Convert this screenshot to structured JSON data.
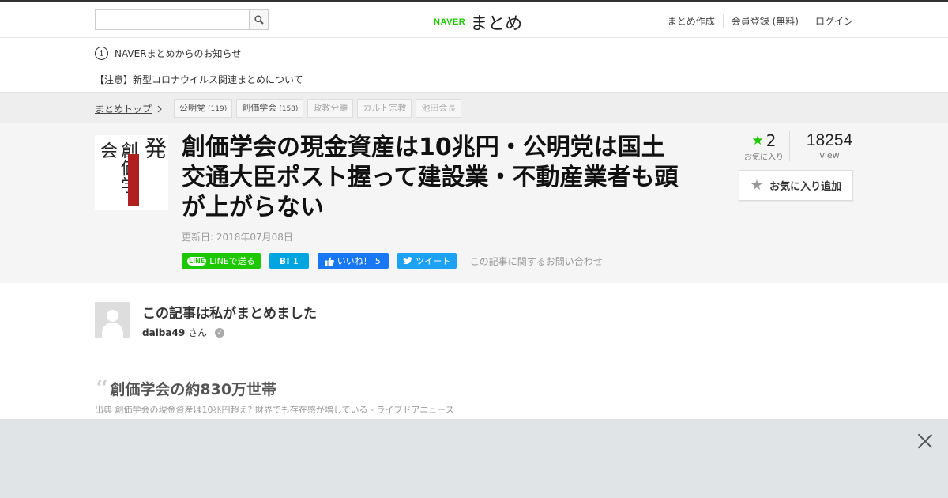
{
  "header": {
    "search": {
      "placeholder": "",
      "value": ""
    },
    "logo": {
      "brand": "NAVER",
      "name": "まとめ"
    },
    "nav": [
      "まとめ作成",
      "会員登録 (無料)",
      "ログイン"
    ]
  },
  "notice": {
    "icon": "info-icon",
    "title": "NAVERまとめからのお知らせ",
    "item": "【注意】新型コロナウイルス関連まとめについて"
  },
  "tagbar": {
    "breadcrumb": "まとめトップ",
    "tags": [
      {
        "label": "公明党",
        "count": "(119)"
      },
      {
        "label": "創価学会",
        "count": "(158)"
      },
      {
        "label": "政教分離",
        "count": ""
      },
      {
        "label": "カルト宗教",
        "count": ""
      },
      {
        "label": "池田会長",
        "count": ""
      }
    ]
  },
  "article": {
    "thumbnail": {
      "col1": "創価学会",
      "col2": "〈名告発"
    },
    "title": "創価学会の現金資産は10兆円・公明党は国土交通大臣ポスト握って建設業・不動産業者も頭が上がらない",
    "updated": "更新日: 2018年07月08日",
    "share": {
      "line_badge": "LINE",
      "line": "LINEで送る",
      "hatena_icon": "B!",
      "hatena_count": "1",
      "fb_label": "いいね！",
      "fb_count": "5",
      "tweet": "ツイート"
    },
    "contact": "この記事に関するお問い合わせ",
    "favorites": {
      "count": "2",
      "label": "お気に入り"
    },
    "views": {
      "count": "18254",
      "label": "view"
    },
    "fav_button": "お気に入り追加"
  },
  "author": {
    "heading": "この記事は私がまとめました",
    "name": "daiba49",
    "suffix": "さん"
  },
  "quote": {
    "mark": "“",
    "text": "創価学会の約830万世帯",
    "source": "出典 創価学会の現金資産は10兆円超え? 財界でも存在感が増している - ライブドアニュース"
  },
  "colors": {
    "brand_green": "#1ec800",
    "hatena_blue": "#00a4de",
    "facebook_blue": "#1877f2",
    "twitter_blue": "#1da1f2"
  }
}
